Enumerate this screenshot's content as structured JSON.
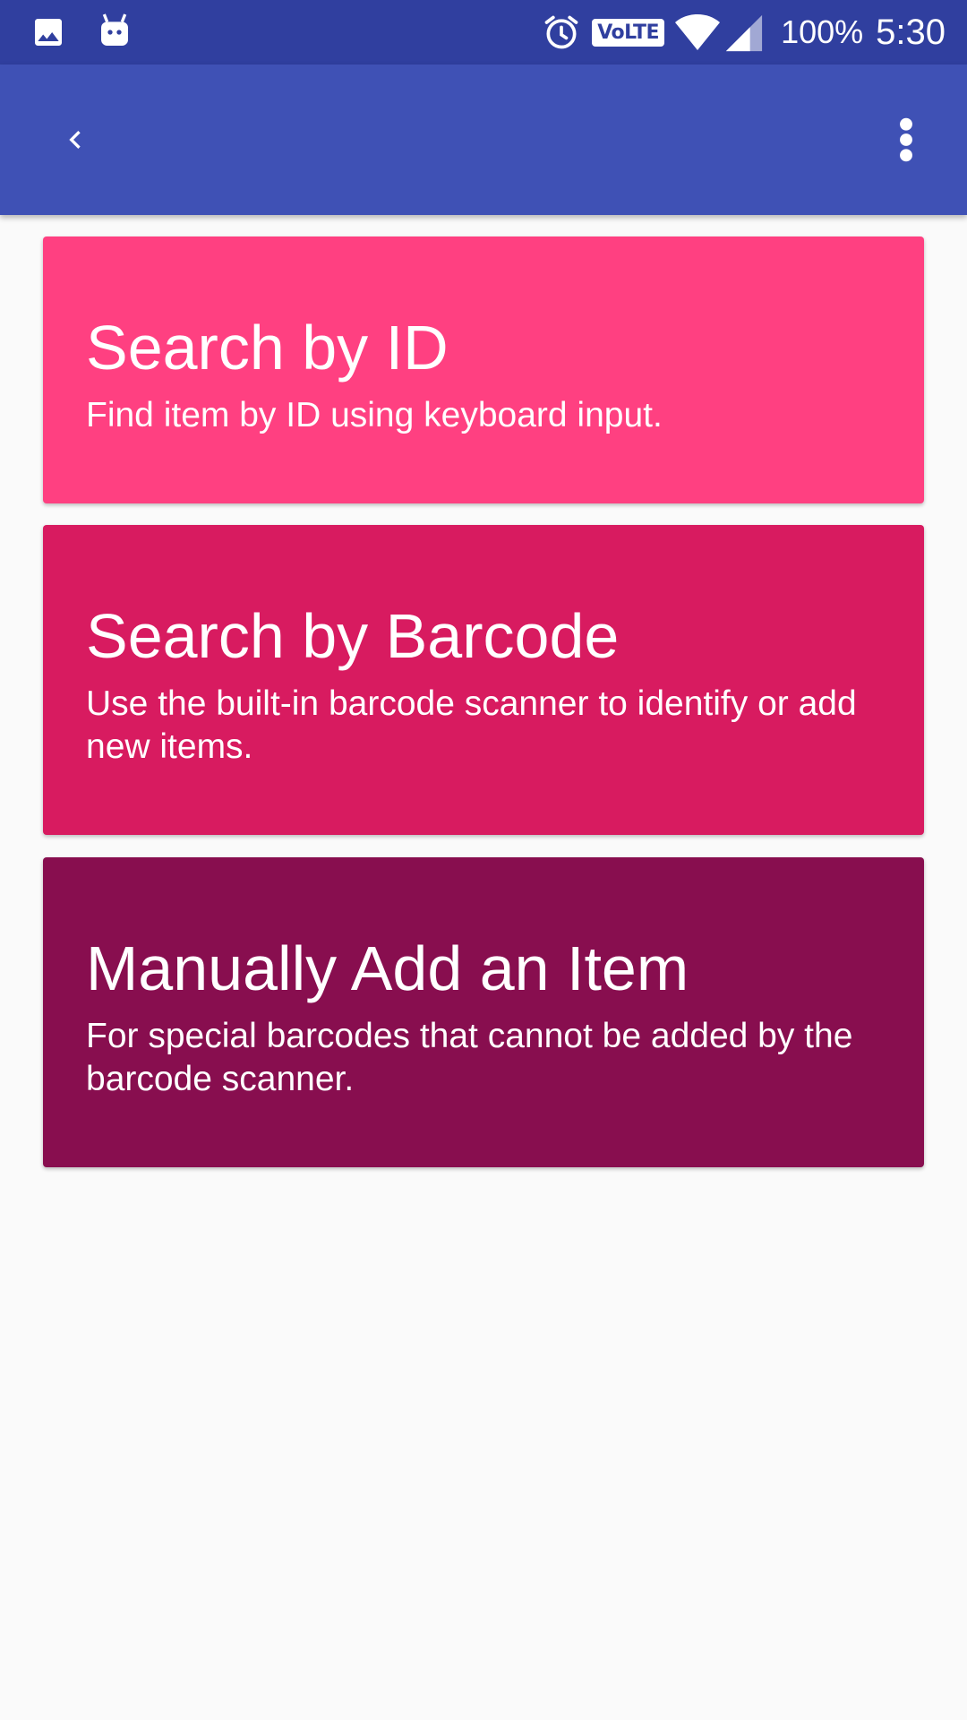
{
  "status_bar": {
    "left_icons": [
      "image-icon",
      "android-icon"
    ],
    "right_icons": [
      "alarm-icon",
      "wifi-icon",
      "signal-icon"
    ],
    "volte": "VoLTE",
    "battery": "100%",
    "time": "5:30",
    "color": "#303f9f"
  },
  "app_bar": {
    "color": "#3f51b5",
    "back_icon": "chevron-left-icon",
    "menu_icon": "more-vert-icon"
  },
  "cards": [
    {
      "title": "Search by ID",
      "description": "Find item by ID using keyboard input.",
      "color": "#ff4081"
    },
    {
      "title": "Search by Barcode",
      "description": "Use the built-in barcode scanner to identify or add new items.",
      "color": "#d81b60"
    },
    {
      "title": "Manually Add an Item",
      "description": "For special barcodes that cannot be added by the barcode scanner.",
      "color": "#880e4f"
    }
  ],
  "background": "#fafafa"
}
